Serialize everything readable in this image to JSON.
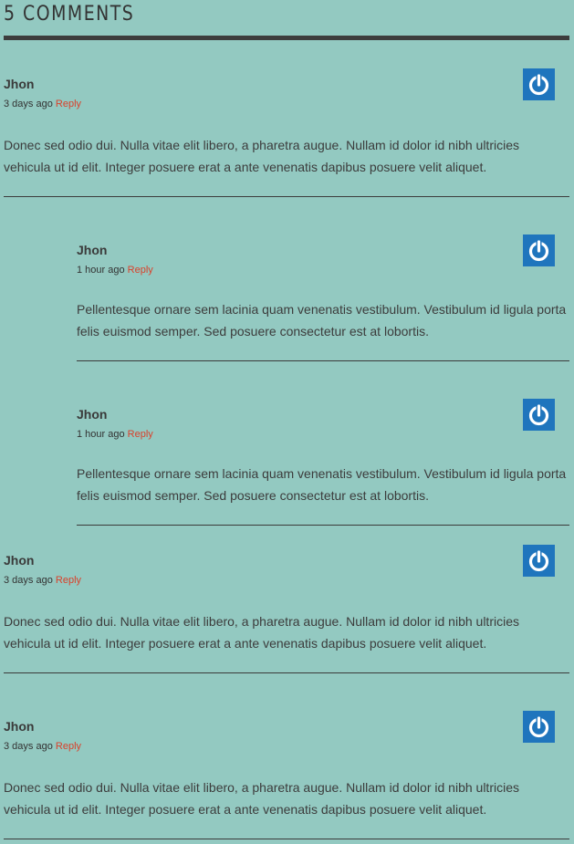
{
  "section": {
    "title": "5 COMMENTS"
  },
  "comments": [
    {
      "author": "Jhon",
      "time": "3 days ago",
      "reply": "Reply",
      "text": "Donec sed odio dui. Nulla vitae elit libero, a pharetra augue. Nullam id dolor id nibh ultricies vehicula ut id elit. Integer posuere erat a ante venenatis dapibus posuere velit aliquet."
    },
    {
      "author": "Jhon",
      "time": "1 hour ago",
      "reply": "Reply",
      "text": "Pellentesque ornare sem lacinia quam venenatis vestibulum. Vestibulum id ligula porta felis euismod semper. Sed posuere consectetur est at lobortis."
    },
    {
      "author": "Jhon",
      "time": "1 hour ago",
      "reply": "Reply",
      "text": "Pellentesque ornare sem lacinia quam venenatis vestibulum. Vestibulum id ligula porta felis euismod semper. Sed posuere consectetur est at lobortis."
    },
    {
      "author": "Jhon",
      "time": "3 days ago",
      "reply": "Reply",
      "text": "Donec sed odio dui. Nulla vitae elit libero, a pharetra augue. Nullam id dolor id nibh ultricies vehicula ut id elit. Integer posuere erat a ante venenatis dapibus posuere velit aliquet."
    },
    {
      "author": "Jhon",
      "time": "3 days ago",
      "reply": "Reply",
      "text": "Donec sed odio dui. Nulla vitae elit libero, a pharetra augue. Nullam id dolor id nibh ultricies vehicula ut id elit. Integer posuere erat a ante venenatis dapibus posuere velit aliquet."
    }
  ],
  "icons": {
    "avatar": "power-icon"
  },
  "colors": {
    "background": "#93c9c1",
    "reply_link": "#d9412b",
    "avatar_bg": "#1f75bd"
  }
}
